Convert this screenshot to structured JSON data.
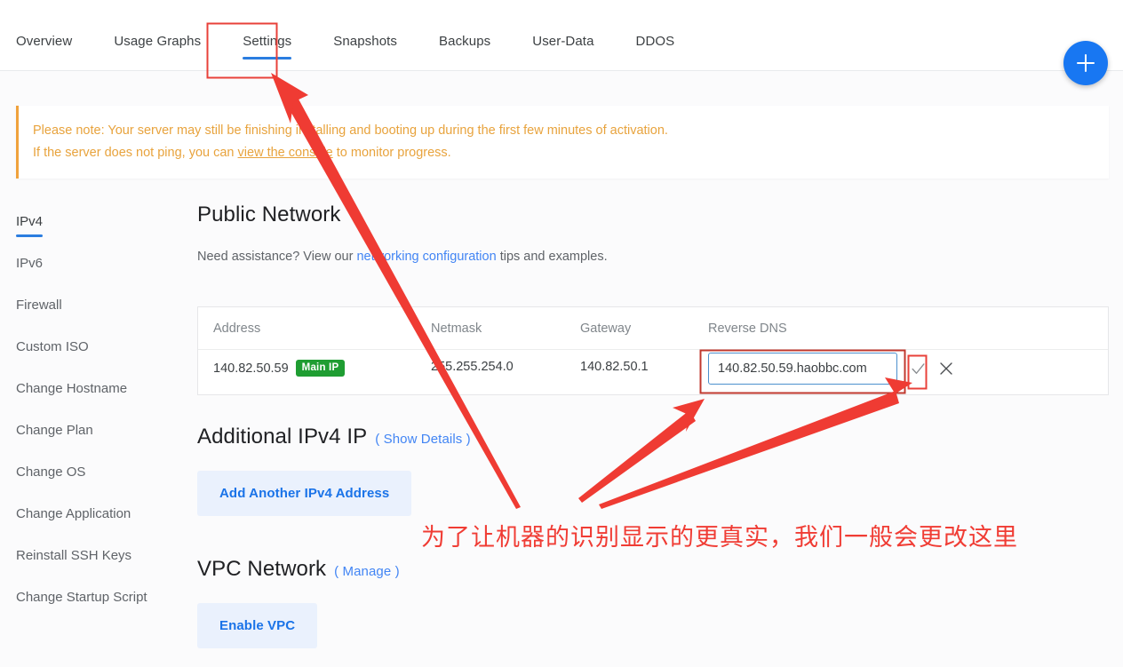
{
  "tabs": [
    {
      "label": "Overview",
      "active": false
    },
    {
      "label": "Usage Graphs",
      "active": false
    },
    {
      "label": "Settings",
      "active": true
    },
    {
      "label": "Snapshots",
      "active": false
    },
    {
      "label": "Backups",
      "active": false
    },
    {
      "label": "User-Data",
      "active": false
    },
    {
      "label": "DDOS",
      "active": false
    }
  ],
  "fab": {
    "icon": "plus-icon"
  },
  "notice": {
    "line1": "Please note: Your server may still be finishing installing and booting up during the first few minutes of activation.",
    "line2_before": "If the server does not ping, you can ",
    "line2_link": "view the console",
    "line2_after": " to monitor progress.",
    "accent_color": "#f0a23c",
    "text_color": "#e8a33d"
  },
  "sidebar": {
    "items": [
      {
        "label": "IPv4",
        "active": true
      },
      {
        "label": "IPv6",
        "active": false
      },
      {
        "label": "Firewall",
        "active": false
      },
      {
        "label": "Custom ISO",
        "active": false
      },
      {
        "label": "Change Hostname",
        "active": false
      },
      {
        "label": "Change Plan",
        "active": false
      },
      {
        "label": "Change OS",
        "active": false
      },
      {
        "label": "Change Application",
        "active": false
      },
      {
        "label": "Reinstall SSH Keys",
        "active": false
      },
      {
        "label": "Change Startup Script",
        "active": false
      }
    ]
  },
  "public_network": {
    "title": "Public Network",
    "sub_before": "Need assistance? View our ",
    "sub_link": "networking configuration",
    "sub_after": " tips and examples.",
    "table": {
      "headers": [
        "Address",
        "Netmask",
        "Gateway",
        "Reverse DNS"
      ],
      "row": {
        "address": "140.82.50.59",
        "badge": "Main IP",
        "netmask": "255.255.254.0",
        "gateway": "140.82.50.1",
        "reverse_dns_value": "140.82.50.59.haobbc.com",
        "reverse_dns_placeholder": "140.82.50.59.haobbc.com",
        "confirm_icon": "check-icon",
        "cancel_icon": "close-icon"
      }
    }
  },
  "additional_ipv4": {
    "title": "Additional IPv4 IP",
    "link": "( Show Details )",
    "button": "Add Another IPv4 Address"
  },
  "vpc_network": {
    "title": "VPC Network",
    "link": "( Manage )",
    "button": "Enable VPC"
  },
  "annotations": {
    "chinese_note": "为了让机器的识别显示的更真实，我们一般会更改这里",
    "color": "#f03c34",
    "highlight_boxes": [
      "settings-tab",
      "reverse-dns-input",
      "confirm-check-icon"
    ],
    "arrows": 3
  }
}
